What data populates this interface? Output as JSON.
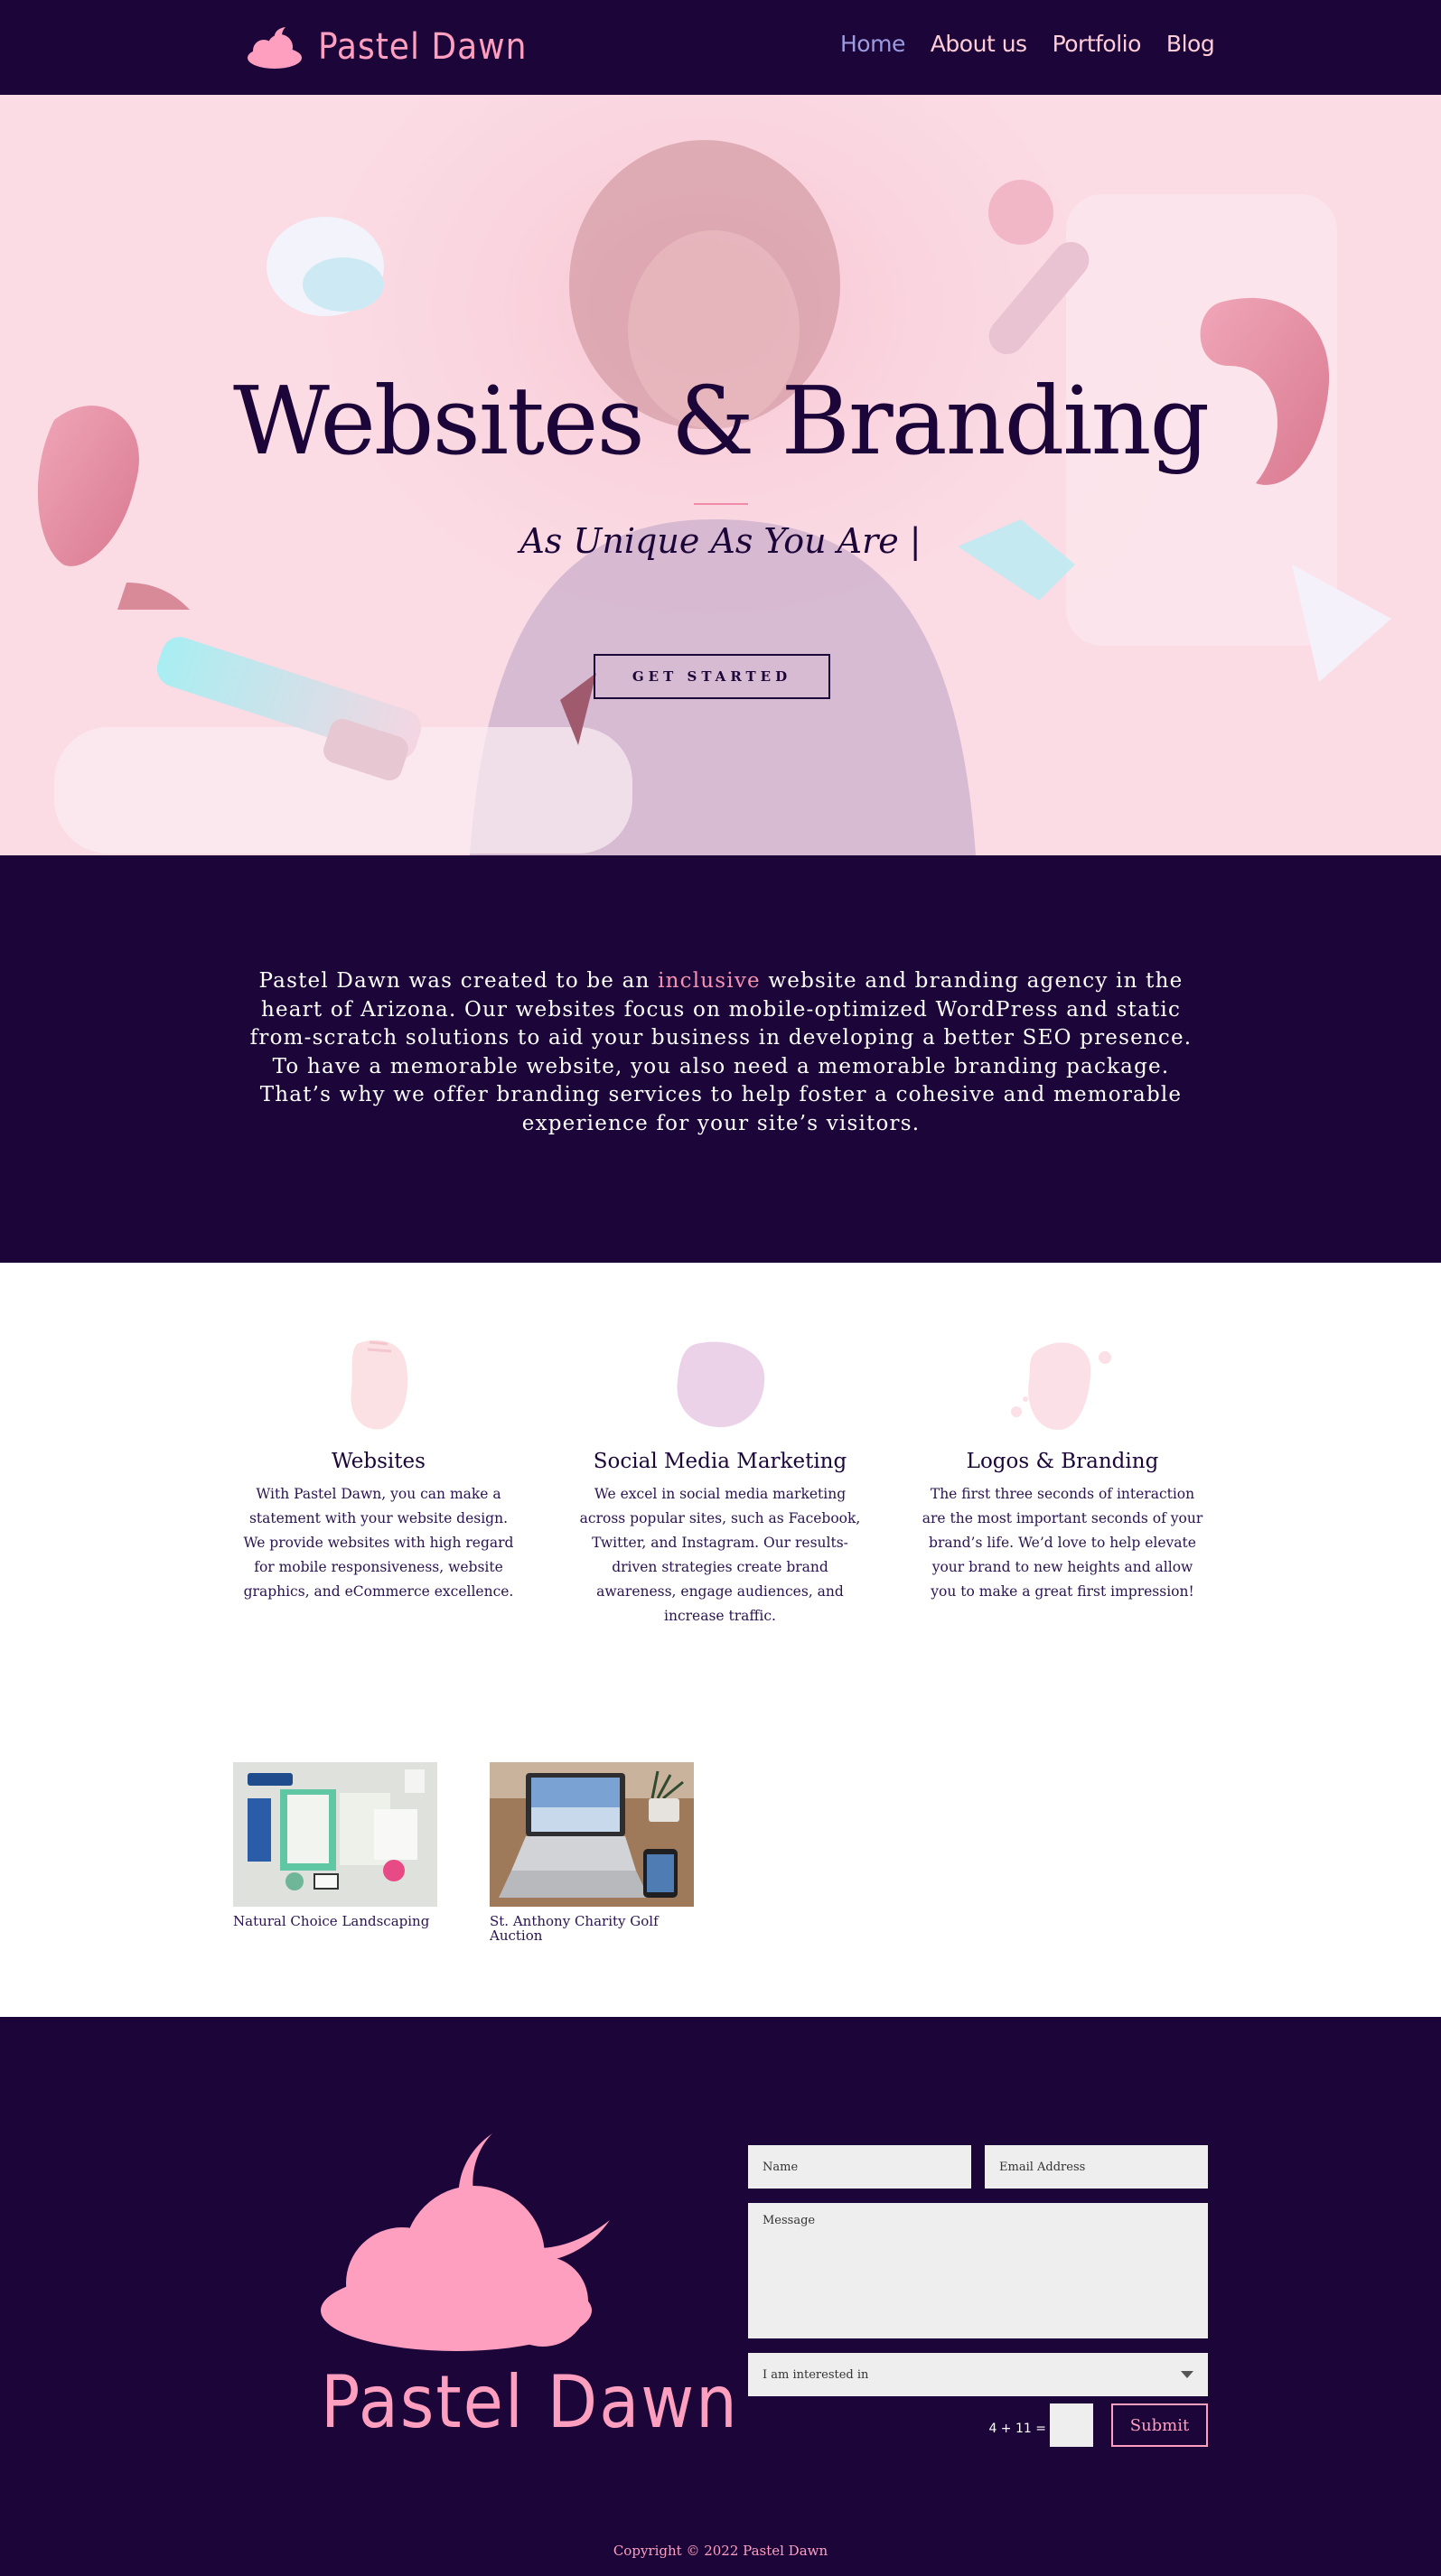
{
  "brand": {
    "name": "Pastel Dawn",
    "primary_color": "#1c0538",
    "accent_color": "#ff9fc0",
    "highlight_color": "#f593b4"
  },
  "nav": {
    "items": [
      {
        "label": "Home",
        "active": true
      },
      {
        "label": "About us",
        "active": false
      },
      {
        "label": "Portfolio",
        "active": false
      },
      {
        "label": "Blog",
        "active": false
      }
    ]
  },
  "hero": {
    "title": "Websites & Branding",
    "subtitle": "As Unique As You Are |",
    "cta_label": "GET STARTED"
  },
  "intro": {
    "text_before": "Pastel Dawn was created to be an ",
    "highlight": "inclusive",
    "text_after": " website and branding agency in the heart of Arizona. Our websites focus on mobile-optimized WordPress and static from-scratch solutions to aid your business in developing a better SEO presence. To have a memorable website, you also need a memorable branding package. That’s why we offer branding services to help foster a cohesive and memorable experience for your site’s visitors."
  },
  "services": [
    {
      "title": "Websites",
      "icon": "pink-brushstroke-icon",
      "description": "With Pastel Dawn, you can make a statement with your website design. We provide websites with high regard for mobile responsiveness, website graphics, and eCommerce excellence."
    },
    {
      "title": "Social Media Marketing",
      "icon": "lavender-blob-icon",
      "description": "We excel in social media marketing across popular sites, such as Facebook, Twitter, and Instagram. Our results-driven strategies create brand awareness, engage audiences, and increase traffic."
    },
    {
      "title": "Logos & Branding",
      "icon": "pink-splash-icon",
      "description": "The first three seconds of interaction are the most important seconds of your brand’s life. We’d love to help elevate your brand to new heights and allow you to make a great first impression!"
    }
  ],
  "portfolio": [
    {
      "caption": "Natural Choice Landscaping",
      "image": "branding-stationery-mockup"
    },
    {
      "caption": "St. Anthony Charity Golf Auction",
      "image": "laptop-website-mockup"
    }
  ],
  "contact_form": {
    "name_placeholder": "Name",
    "email_placeholder": "Email Address",
    "message_placeholder": "Message",
    "interest_select": "I am interested in",
    "captcha_question": "4 + 11 =",
    "submit_label": "Submit"
  },
  "footer": {
    "logo_text": "Pastel Dawn",
    "copyright": "Copyright © 2022 Pastel Dawn"
  }
}
